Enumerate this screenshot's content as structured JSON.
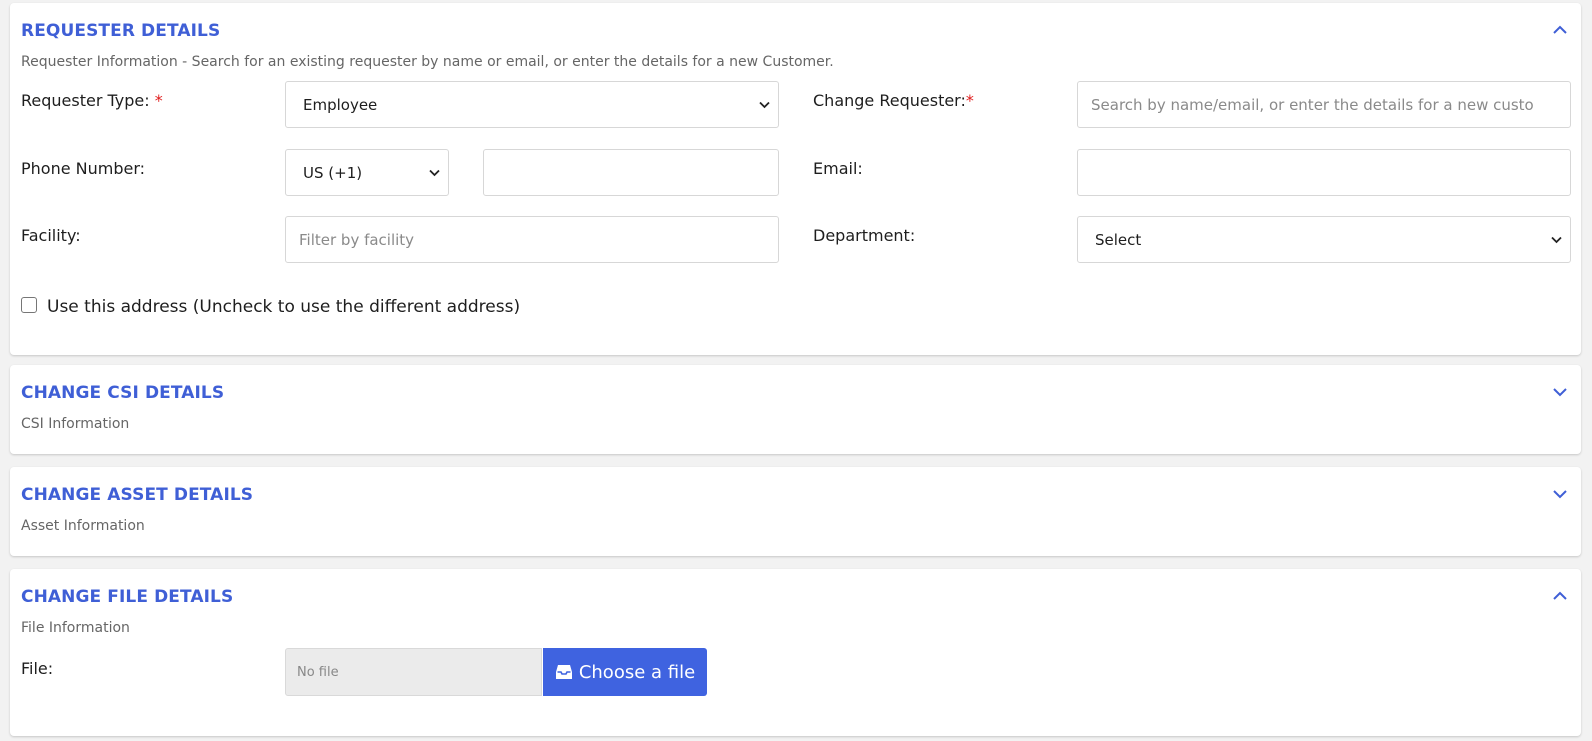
{
  "requester": {
    "title": "REQUESTER DETAILS",
    "subtitle": "Requester Information - Search for an existing requester by name or email, or enter the details for a new Customer.",
    "requester_type_label": "Requester Type:",
    "required_mark": "*",
    "requester_type_value": "Employee",
    "change_requester_label": "Change Requester:",
    "change_requester_placeholder": "Search by name/email, or enter the details for a new custo",
    "phone_label": "Phone Number:",
    "phone_country_value": "US (+1)",
    "phone_number_value": "",
    "email_label": "Email:",
    "email_value": "",
    "facility_label": "Facility:",
    "facility_placeholder": "Filter by facility",
    "department_label": "Department:",
    "department_value": "Select",
    "use_address_label": "Use this address (Uncheck to use the different address)",
    "use_address_checked": false
  },
  "csi": {
    "title": "CHANGE CSI DETAILS",
    "subtitle": "CSI Information"
  },
  "asset": {
    "title": "CHANGE ASSET DETAILS",
    "subtitle": "Asset Information"
  },
  "file": {
    "title": "CHANGE FILE DETAILS",
    "subtitle": "File Information",
    "file_label": "File:",
    "file_status": "No file",
    "choose_button": "Choose a file",
    "choose_icon": "inbox-icon"
  },
  "colors": {
    "accent": "#3f5fd6",
    "button": "#3f63e0",
    "required": "#e01b1b"
  }
}
